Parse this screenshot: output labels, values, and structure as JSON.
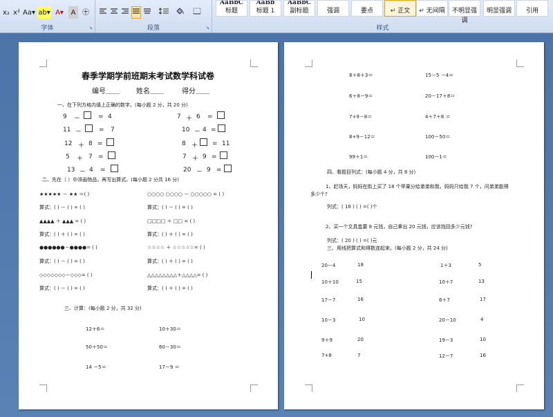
{
  "ribbon": {
    "font_group_label": "字体",
    "paragraph_group_label": "段落",
    "styles_group_label": "样式",
    "font_buttons": [
      "x₂",
      "x²",
      "Aa▾",
      "ab▾",
      "A▾",
      "A",
      "㊉"
    ],
    "styles": [
      {
        "preview": "AaBbC",
        "name": "标题"
      },
      {
        "preview": "AaBb",
        "name": "标题 1"
      },
      {
        "preview": "AaBbC",
        "name": "副标题"
      },
      {
        "preview": "",
        "name": "强调"
      },
      {
        "preview": "",
        "name": "要点"
      },
      {
        "preview": "",
        "name": "↵ 正文"
      },
      {
        "preview": "",
        "name": "↵ 无间隔"
      },
      {
        "preview": "",
        "name": "不明显强调"
      },
      {
        "preview": "",
        "name": "明显强调"
      },
      {
        "preview": "",
        "name": "引用"
      }
    ]
  },
  "page1": {
    "title": "春季学期学前班期末考试数学科试卷",
    "info": {
      "number": "编号＿＿",
      "name": "姓名＿＿",
      "score": "得分＿＿"
    },
    "section1": {
      "heading": "一、在下列方格内填上正确的数字。(每小题 2 分，共 20 分)",
      "left": [
        [
          "9",
          "－",
          "=",
          "4"
        ],
        [
          "11",
          "－",
          "=",
          "7"
        ],
        [
          "12",
          "＋",
          "8",
          "="
        ],
        [
          "5",
          "＋",
          "7",
          "="
        ],
        [
          "13",
          "－",
          "4",
          "="
        ]
      ],
      "right": [
        [
          "7",
          "＋",
          "6",
          "="
        ],
        [
          "10",
          "－",
          "4",
          "="
        ],
        [
          "8",
          "＋",
          "=",
          "11"
        ],
        [
          "7",
          "＋",
          "9",
          "="
        ],
        [
          "20",
          "－",
          "9",
          "="
        ]
      ]
    },
    "section2": {
      "heading": "二、先在（ ）中添画物品，再写出算式。(每小题 2 分共 16 分)",
      "rows": [
        {
          "left": "★★★★★ － ★★ ＝(        )",
          "right": "○○○○  ○○○○ － ○○○○○ = (        )"
        },
        {
          "left": "算式：(   ) － (    ) = (     )",
          "right": "算式：(   ) － (    ) = (     )"
        },
        {
          "left": "▲▲▲▲ ＋ ▲▲▲ = (                )",
          "right": "□□□□ ＋ □□ = (                )"
        },
        {
          "left": "算式：(   ) ＋ (    ) = (     )",
          "right": "算式：(   ) ＋ (    ) = (     )"
        },
        {
          "left": "●●●●●●－●●●●= (        )",
          "right": "☆☆☆☆ ＋ ☆☆☆☆☆= (              )"
        },
        {
          "left": "算式：(   ) － (    ) = (     )",
          "right": "算式：(   ) ＋ (    ) = (     )"
        },
        {
          "left": "◇◇◇◇◇◇◇－◇◇◇= (        )",
          "right": "△△△△△△△△＋△△△△= (        )"
        },
        {
          "left": "算式：(   ) － (    ) = (     )",
          "right": "算式：(   ) ＋ (    ) = (     )"
        }
      ]
    },
    "section3": {
      "heading": "三、计算：(每小题 2 分，共 32 分)",
      "rows": [
        [
          "12＋6＝",
          "10＋30＝"
        ],
        [
          "50＋50＝",
          "60－30＝"
        ],
        [
          "14 －5＝",
          "17－9 ＝"
        ]
      ]
    }
  },
  "page2": {
    "calc_rows": [
      [
        "8＋8＋3＝",
        "15－5 －4＝"
      ],
      [
        "6＋8－9＝",
        "20－17＋8＝"
      ],
      [
        "7+9－8＝",
        "4＋7＋8 ＝"
      ],
      [
        "8+9－12＝",
        "100－50＝"
      ],
      [
        "99＋1＝",
        "100－1＝"
      ]
    ],
    "section4": {
      "heading": "四、看题目列式：(每小题 4 分，共 8 分)",
      "q1_line1": "1、赶场天，妈妈在街上买了 18 个苹果分给弟弟和我，妈妈只给我 7 个，问弟弟能得",
      "q1_line2": "多少个?",
      "q1_answer": "列式：(   18   )     (        )    =(      )个",
      "q2_line": "2、买一个文具盒要 8 元钱，自己拿出 20 元钱，应该找回多少元钱?",
      "q2_answer": "列式：(   20   )     (        )    =(      )元"
    },
    "section5": {
      "heading": "三、用线把算式和得数连起来。(每小题 2 分，共 24 分)",
      "rows": [
        [
          "20－4",
          "18",
          "1＋3",
          "5"
        ],
        [
          "10＋10",
          "15",
          "10＋7",
          "13"
        ],
        [
          "17－7",
          "16",
          "6＋7",
          "17"
        ],
        [
          "10－3",
          "10",
          "20－10",
          "4"
        ],
        [
          "9＋9",
          "20",
          "19－3",
          "10"
        ],
        [
          "7+8",
          "7",
          "12－7",
          "16"
        ]
      ]
    }
  }
}
